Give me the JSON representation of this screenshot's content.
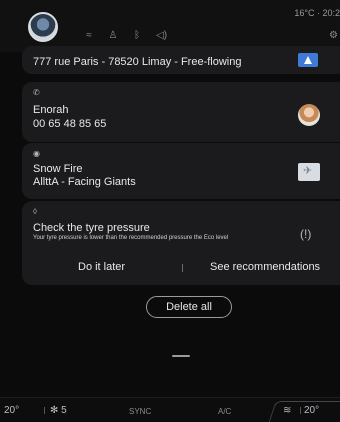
{
  "status_bar": {
    "temperature_time": "16°C · 20:2",
    "icons": [
      "wifi-icon",
      "person-icon",
      "bluetooth-icon",
      "volume-icon"
    ]
  },
  "notifications": {
    "navigation": {
      "text": "777 rue Paris - 78520 Limay - Free-flowing"
    },
    "phone": {
      "name": "Enorah",
      "number": "00 65 48 85 65"
    },
    "music": {
      "title": "Snow Fire",
      "subtitle": "AllttA - Facing Giants"
    },
    "warning": {
      "title": "Check the tyre pressure",
      "description": "Your tyre pressure is lower than the recommended pressure the Eco level",
      "action_later": "Do it later",
      "action_recommendations": "See recommendations"
    }
  },
  "delete_all_label": "Delete all",
  "climate": {
    "left_temp": "20",
    "fan_level": "5",
    "sync_label": "SYNC",
    "ac_label": "A/C",
    "right_temp": "20"
  },
  "colors": {
    "background": "#0b0b0c",
    "card": "#1b1b1d",
    "nav_accent": "#3e7ad6"
  }
}
